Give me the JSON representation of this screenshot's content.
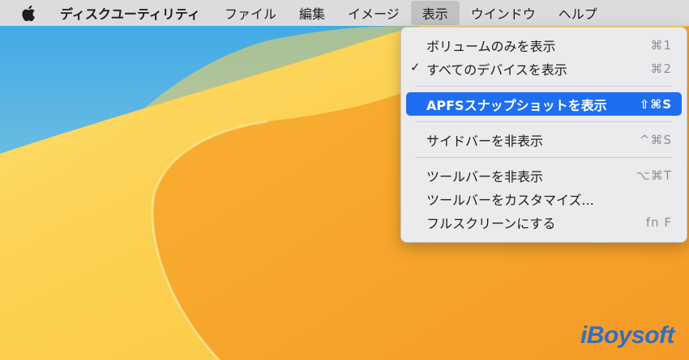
{
  "menubar": {
    "app_name": "ディスクユーティリティ",
    "items": [
      "ファイル",
      "編集",
      "イメージ",
      "表示",
      "ウインドウ",
      "ヘルプ"
    ]
  },
  "view_menu": {
    "items": [
      {
        "label": "ボリュームのみを表示",
        "shortcut": "⌘1",
        "checked": false
      },
      {
        "label": "すべてのデバイスを表示",
        "shortcut": "⌘2",
        "checked": true
      },
      {
        "label": "APFSスナップショットを表示",
        "shortcut": "⇧⌘S",
        "selected": true
      },
      {
        "label": "サイドバーを非表示",
        "shortcut": "^⌘S"
      },
      {
        "label": "ツールバーを非表示",
        "shortcut": "⌥⌘T"
      },
      {
        "label": "ツールバーをカスタマイズ...",
        "shortcut": ""
      },
      {
        "label": "フルスクリーンにする",
        "shortcut": "fn F"
      }
    ],
    "check_glyph": "✓"
  },
  "watermark": "iBoysoft",
  "colors": {
    "menubar_bg": "#dcdcde",
    "menu_bg": "#ebebed",
    "selection": "#1f6ef0",
    "wallpaper_yellow": "#fbd04a",
    "wallpaper_orange": "#f6a935",
    "wallpaper_blue": "#4fb1e6",
    "watermark": "#2f6fc6"
  }
}
